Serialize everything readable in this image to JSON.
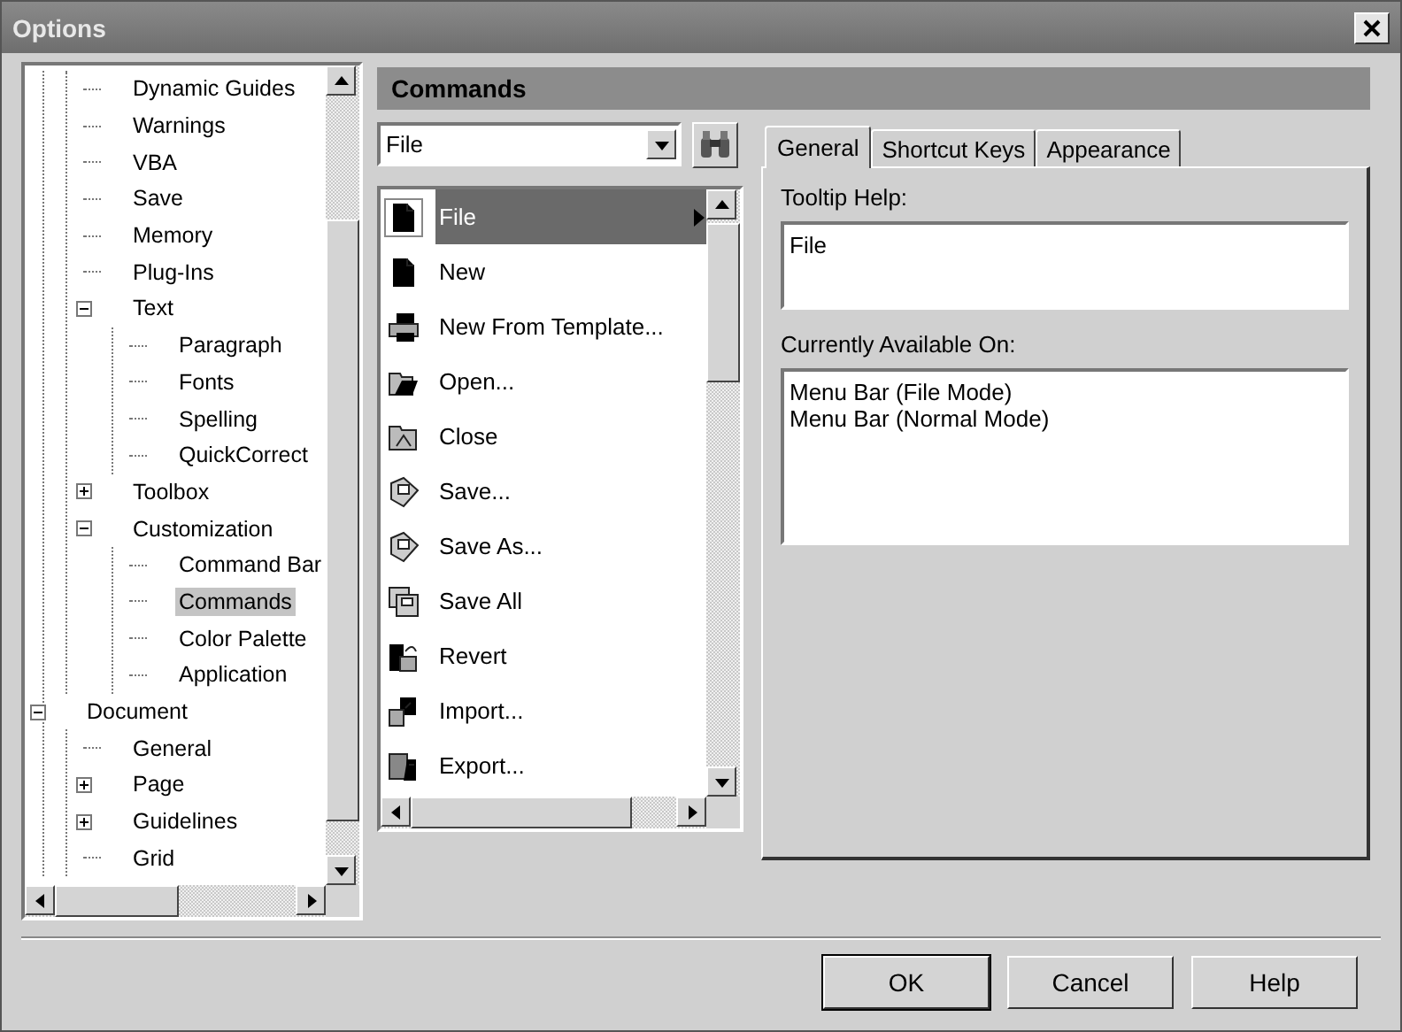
{
  "window": {
    "title": "Options"
  },
  "tree": {
    "items": [
      {
        "children": [
          {
            "children": [
              {
                "label": "Dynamic Guides",
                "selected": false
              },
              {
                "label": "Warnings",
                "selected": false
              },
              {
                "label": "VBA",
                "selected": false
              },
              {
                "label": "Save",
                "selected": false
              },
              {
                "label": "Memory",
                "selected": false
              },
              {
                "label": "Plug-Ins",
                "selected": false
              },
              {
                "label": "Text",
                "selected": false,
                "expanded": true,
                "children": [
                  {
                    "label": "Paragraph",
                    "selected": false
                  },
                  {
                    "label": "Fonts",
                    "selected": false
                  },
                  {
                    "label": "Spelling",
                    "selected": false
                  },
                  {
                    "label": "QuickCorrect",
                    "selected": false
                  }
                ]
              },
              {
                "label": "Toolbox",
                "selected": false,
                "expanded": false
              },
              {
                "label": "Customization",
                "selected": false,
                "expanded": true,
                "children": [
                  {
                    "label": "Command Bar",
                    "selected": false
                  },
                  {
                    "label": "Commands",
                    "selected": true
                  },
                  {
                    "label": "Color Palette",
                    "selected": false
                  },
                  {
                    "label": "Application",
                    "selected": false
                  }
                ]
              }
            ]
          },
          {
            "label": "Document",
            "selected": false,
            "expanded": true,
            "children": [
              {
                "label": "General",
                "selected": false
              },
              {
                "label": "Page",
                "selected": false,
                "expanded": false
              },
              {
                "label": "Guidelines",
                "selected": false,
                "expanded": false
              },
              {
                "label": "Grid",
                "selected": false
              }
            ]
          }
        ]
      }
    ]
  },
  "section_title": "Commands",
  "category": {
    "value": "File"
  },
  "commands": [
    {
      "label": "File",
      "selected": true,
      "submenu": true
    },
    {
      "label": "New",
      "selected": false,
      "submenu": false
    },
    {
      "label": "New From Template...",
      "selected": false,
      "submenu": false
    },
    {
      "label": "Open...",
      "selected": false,
      "submenu": false
    },
    {
      "label": "Close",
      "selected": false,
      "submenu": false
    },
    {
      "label": "Save...",
      "selected": false,
      "submenu": false
    },
    {
      "label": "Save As...",
      "selected": false,
      "submenu": false
    },
    {
      "label": "Save All",
      "selected": false,
      "submenu": false
    },
    {
      "label": "Revert",
      "selected": false,
      "submenu": false
    },
    {
      "label": "Import...",
      "selected": false,
      "submenu": false
    },
    {
      "label": "Export...",
      "selected": false,
      "submenu": false
    }
  ],
  "tabs": [
    {
      "label": "General",
      "selected": true
    },
    {
      "label": "Shortcut Keys",
      "selected": false
    },
    {
      "label": "Appearance",
      "selected": false
    }
  ],
  "general": {
    "tooltip_label": "Tooltip Help:",
    "tooltip_value": "File",
    "available_label": "Currently Available On:",
    "available_items": [
      "Menu Bar (File Mode)",
      "Menu Bar (Normal Mode)"
    ]
  },
  "buttons": [
    {
      "label": "OK",
      "default": true
    },
    {
      "label": "Cancel",
      "default": false
    },
    {
      "label": "Help",
      "default": false
    }
  ]
}
